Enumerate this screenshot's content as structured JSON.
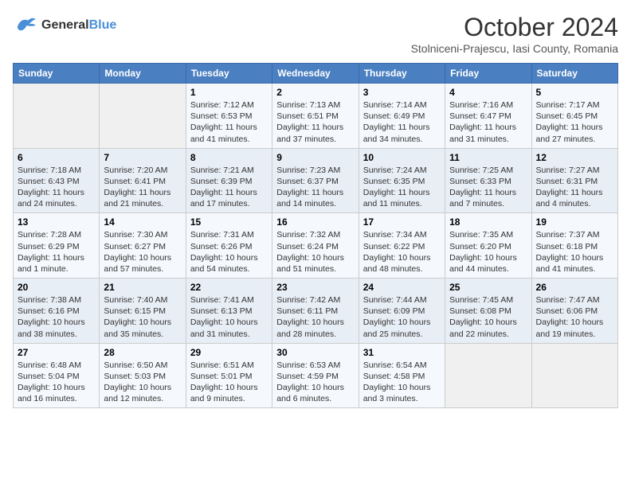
{
  "header": {
    "logo_line1": "General",
    "logo_line2": "Blue",
    "month": "October 2024",
    "location": "Stolniceni-Prajescu, Iasi County, Romania"
  },
  "weekdays": [
    "Sunday",
    "Monday",
    "Tuesday",
    "Wednesday",
    "Thursday",
    "Friday",
    "Saturday"
  ],
  "rows": [
    [
      {
        "num": "",
        "detail": ""
      },
      {
        "num": "",
        "detail": ""
      },
      {
        "num": "1",
        "detail": "Sunrise: 7:12 AM\nSunset: 6:53 PM\nDaylight: 11 hours and 41 minutes."
      },
      {
        "num": "2",
        "detail": "Sunrise: 7:13 AM\nSunset: 6:51 PM\nDaylight: 11 hours and 37 minutes."
      },
      {
        "num": "3",
        "detail": "Sunrise: 7:14 AM\nSunset: 6:49 PM\nDaylight: 11 hours and 34 minutes."
      },
      {
        "num": "4",
        "detail": "Sunrise: 7:16 AM\nSunset: 6:47 PM\nDaylight: 11 hours and 31 minutes."
      },
      {
        "num": "5",
        "detail": "Sunrise: 7:17 AM\nSunset: 6:45 PM\nDaylight: 11 hours and 27 minutes."
      }
    ],
    [
      {
        "num": "6",
        "detail": "Sunrise: 7:18 AM\nSunset: 6:43 PM\nDaylight: 11 hours and 24 minutes."
      },
      {
        "num": "7",
        "detail": "Sunrise: 7:20 AM\nSunset: 6:41 PM\nDaylight: 11 hours and 21 minutes."
      },
      {
        "num": "8",
        "detail": "Sunrise: 7:21 AM\nSunset: 6:39 PM\nDaylight: 11 hours and 17 minutes."
      },
      {
        "num": "9",
        "detail": "Sunrise: 7:23 AM\nSunset: 6:37 PM\nDaylight: 11 hours and 14 minutes."
      },
      {
        "num": "10",
        "detail": "Sunrise: 7:24 AM\nSunset: 6:35 PM\nDaylight: 11 hours and 11 minutes."
      },
      {
        "num": "11",
        "detail": "Sunrise: 7:25 AM\nSunset: 6:33 PM\nDaylight: 11 hours and 7 minutes."
      },
      {
        "num": "12",
        "detail": "Sunrise: 7:27 AM\nSunset: 6:31 PM\nDaylight: 11 hours and 4 minutes."
      }
    ],
    [
      {
        "num": "13",
        "detail": "Sunrise: 7:28 AM\nSunset: 6:29 PM\nDaylight: 11 hours and 1 minute."
      },
      {
        "num": "14",
        "detail": "Sunrise: 7:30 AM\nSunset: 6:27 PM\nDaylight: 10 hours and 57 minutes."
      },
      {
        "num": "15",
        "detail": "Sunrise: 7:31 AM\nSunset: 6:26 PM\nDaylight: 10 hours and 54 minutes."
      },
      {
        "num": "16",
        "detail": "Sunrise: 7:32 AM\nSunset: 6:24 PM\nDaylight: 10 hours and 51 minutes."
      },
      {
        "num": "17",
        "detail": "Sunrise: 7:34 AM\nSunset: 6:22 PM\nDaylight: 10 hours and 48 minutes."
      },
      {
        "num": "18",
        "detail": "Sunrise: 7:35 AM\nSunset: 6:20 PM\nDaylight: 10 hours and 44 minutes."
      },
      {
        "num": "19",
        "detail": "Sunrise: 7:37 AM\nSunset: 6:18 PM\nDaylight: 10 hours and 41 minutes."
      }
    ],
    [
      {
        "num": "20",
        "detail": "Sunrise: 7:38 AM\nSunset: 6:16 PM\nDaylight: 10 hours and 38 minutes."
      },
      {
        "num": "21",
        "detail": "Sunrise: 7:40 AM\nSunset: 6:15 PM\nDaylight: 10 hours and 35 minutes."
      },
      {
        "num": "22",
        "detail": "Sunrise: 7:41 AM\nSunset: 6:13 PM\nDaylight: 10 hours and 31 minutes."
      },
      {
        "num": "23",
        "detail": "Sunrise: 7:42 AM\nSunset: 6:11 PM\nDaylight: 10 hours and 28 minutes."
      },
      {
        "num": "24",
        "detail": "Sunrise: 7:44 AM\nSunset: 6:09 PM\nDaylight: 10 hours and 25 minutes."
      },
      {
        "num": "25",
        "detail": "Sunrise: 7:45 AM\nSunset: 6:08 PM\nDaylight: 10 hours and 22 minutes."
      },
      {
        "num": "26",
        "detail": "Sunrise: 7:47 AM\nSunset: 6:06 PM\nDaylight: 10 hours and 19 minutes."
      }
    ],
    [
      {
        "num": "27",
        "detail": "Sunrise: 6:48 AM\nSunset: 5:04 PM\nDaylight: 10 hours and 16 minutes."
      },
      {
        "num": "28",
        "detail": "Sunrise: 6:50 AM\nSunset: 5:03 PM\nDaylight: 10 hours and 12 minutes."
      },
      {
        "num": "29",
        "detail": "Sunrise: 6:51 AM\nSunset: 5:01 PM\nDaylight: 10 hours and 9 minutes."
      },
      {
        "num": "30",
        "detail": "Sunrise: 6:53 AM\nSunset: 4:59 PM\nDaylight: 10 hours and 6 minutes."
      },
      {
        "num": "31",
        "detail": "Sunrise: 6:54 AM\nSunset: 4:58 PM\nDaylight: 10 hours and 3 minutes."
      },
      {
        "num": "",
        "detail": ""
      },
      {
        "num": "",
        "detail": ""
      }
    ]
  ]
}
